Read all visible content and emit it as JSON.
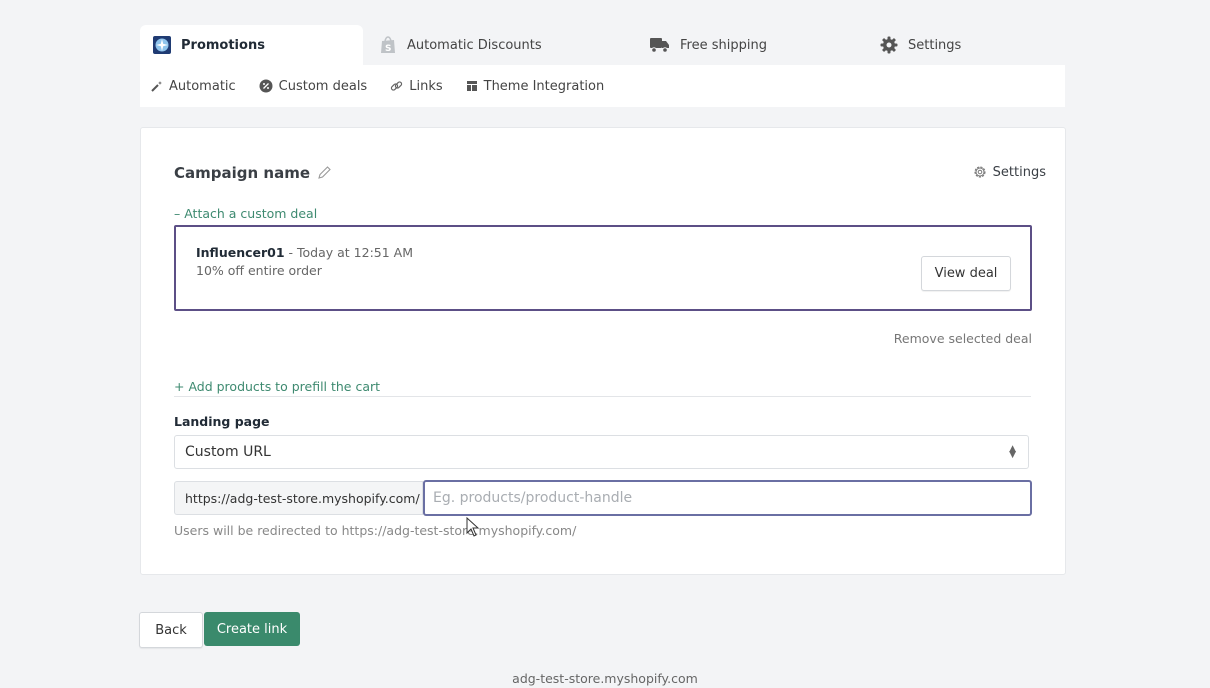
{
  "tabs": [
    {
      "label": "Promotions",
      "icon": "app-logo-icon",
      "active": true
    },
    {
      "label": "Automatic Discounts",
      "icon": "shopify-bag-icon",
      "active": false
    },
    {
      "label": "Free shipping",
      "icon": "truck-icon",
      "active": false
    },
    {
      "label": "Settings",
      "icon": "gear-icon",
      "active": false
    }
  ],
  "subnav": [
    {
      "label": "Automatic",
      "icon": "magic-wand-icon"
    },
    {
      "label": "Custom deals",
      "icon": "badge-percent-icon"
    },
    {
      "label": "Links",
      "icon": "link-icon"
    },
    {
      "label": "Theme Integration",
      "icon": "layout-icon"
    }
  ],
  "card": {
    "campaign_name": "Campaign name",
    "settings_label": "Settings",
    "attach_toggle": "– Attach a custom deal",
    "deal": {
      "name": "Influencer01",
      "meta": " - Today at 12:51 AM",
      "description": "10% off entire order",
      "view_button": "View deal"
    },
    "remove_deal": "Remove selected deal",
    "add_products": "+ Add products to prefill the cart",
    "landing_label": "Landing page",
    "landing_select_value": "Custom URL",
    "url_prefix": "https://adg-test-store.myshopify.com/",
    "url_placeholder": "Eg. products/product-handle",
    "url_value": "",
    "help_text": "Users will be redirected to https://adg-test-store.myshopify.com/"
  },
  "actions": {
    "back": "Back",
    "create": "Create link"
  },
  "footer": "adg-test-store.myshopify.com",
  "colors": {
    "accent_green": "#3a8a6c",
    "deal_border": "#5c4f86",
    "link_green": "#3e8a70"
  }
}
